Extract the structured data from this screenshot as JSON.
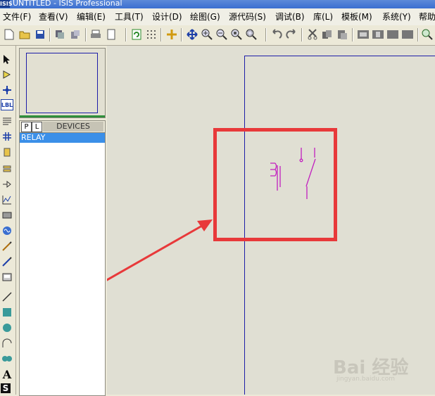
{
  "window": {
    "title": "UNTITLED - ISIS Professional",
    "app_icon": "ISIS"
  },
  "menu": [
    "文件(F)",
    "查看(V)",
    "编辑(E)",
    "工具(T)",
    "设计(D)",
    "绘图(G)",
    "源代码(S)",
    "调试(B)",
    "库(L)",
    "模板(M)",
    "系统(Y)",
    "帮助"
  ],
  "toolbar_icons": [
    "new-file-icon",
    "open-folder-icon",
    "save-icon",
    "import-icon",
    "export-icon",
    "print-icon",
    "page-setup-icon",
    "refresh-icon",
    "grid-icon",
    "origin-icon",
    "pan-icon",
    "zoom-in-icon",
    "zoom-out-icon",
    "zoom-all-icon",
    "zoom-area-icon",
    "undo-icon",
    "redo-icon",
    "cut-icon",
    "copy-icon",
    "paste-icon",
    "block-copy-icon",
    "block-move-icon",
    "block-rotate-icon",
    "block-delete-icon",
    "pick-device-icon"
  ],
  "tool_icons": [
    "selection-icon",
    "component-icon",
    "junction-icon",
    "wire-label-icon",
    "text-script-icon",
    "bus-icon",
    "subcircuit-icon",
    "terminal-icon",
    "device-pin-icon",
    "graph-icon",
    "tape-recorder-icon",
    "generator-icon",
    "voltage-probe-icon",
    "current-probe-icon",
    "virtual-instrument-icon",
    "line-icon",
    "box-icon",
    "circle-icon",
    "arc-icon",
    "path-icon",
    "text-icon",
    "symbol-icon"
  ],
  "tool_labels": {
    "wire_label": "LBL",
    "text": "A",
    "symbol": "S"
  },
  "device_panel": {
    "p_button": "P",
    "l_button": "L",
    "title": "DEVICES",
    "items": [
      "RELAY"
    ]
  },
  "watermark": {
    "text": "Bai 经验",
    "url": "jingyan.baidu.com"
  },
  "colors": {
    "highlight": "#e8393a",
    "arrow": "#e8393a",
    "component": "#c21fbf",
    "sheet_border": "#1d1da8",
    "selected": "#3b8fe8"
  }
}
